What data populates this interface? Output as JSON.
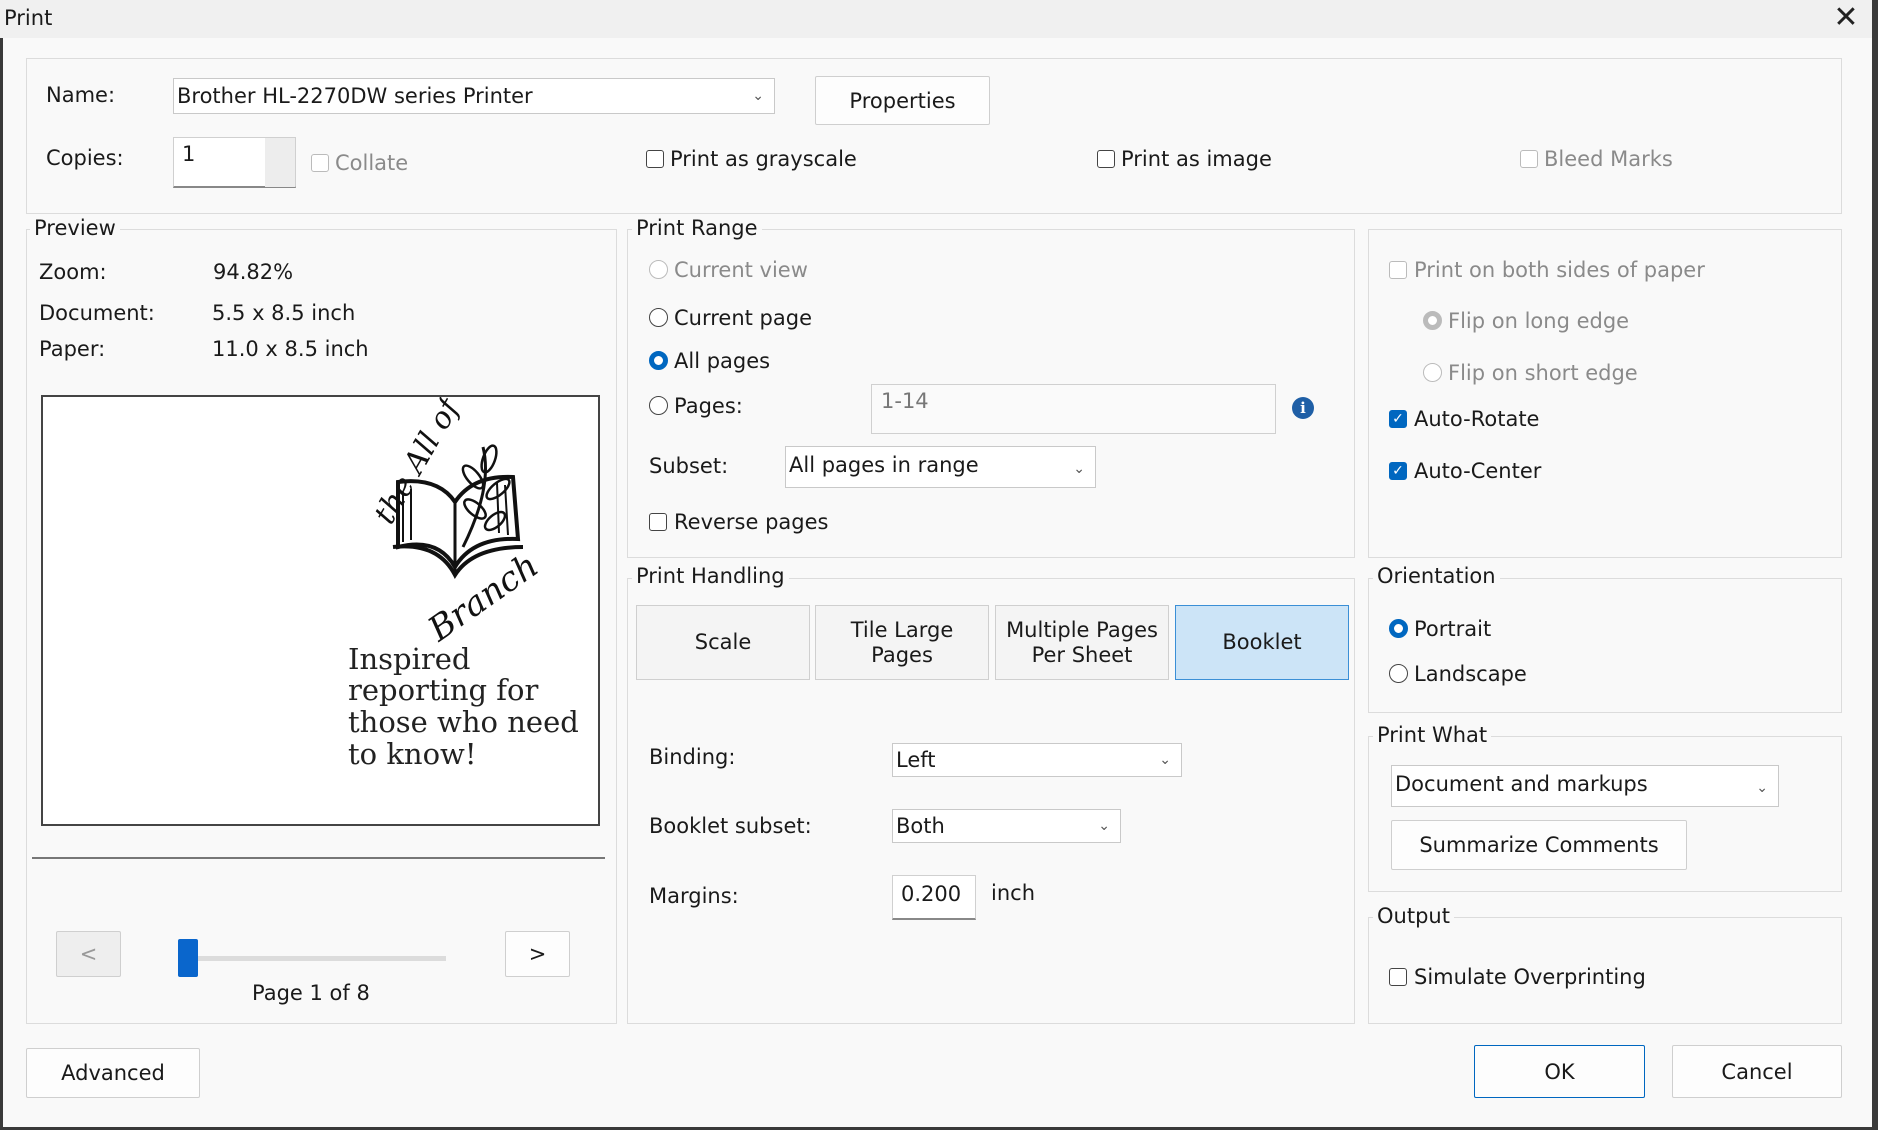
{
  "window": {
    "title": "Print",
    "close_glyph": "✕"
  },
  "printer": {
    "name_label": "Name:",
    "name_value": "Brother HL-2270DW series Printer",
    "properties_label": "Properties",
    "copies_label": "Copies:",
    "copies_value": "1",
    "collate_label": "Collate",
    "grayscale_label": "Print as grayscale",
    "image_label": "Print as image",
    "bleed_label": "Bleed Marks"
  },
  "preview": {
    "legend": "Preview",
    "zoom_label": "Zoom:",
    "zoom_value": "94.82%",
    "document_label": "Document:",
    "document_value": "5.5 x 8.5 inch",
    "paper_label": "Paper:",
    "paper_value": "11.0 x 8.5 inch",
    "logo_text_top": "the All of",
    "logo_text_bottom": "Branch",
    "tagline_1": "Inspired",
    "tagline_2": "reporting for",
    "tagline_3": "those who need",
    "tagline_4": "to know!",
    "prev_label": "<",
    "next_label": ">",
    "page_label": "Page 1 of 8",
    "slider_position": 0.0
  },
  "print_range": {
    "legend": "Print Range",
    "current_view": "Current view",
    "current_page": "Current page",
    "all_pages": "All pages",
    "pages_label": "Pages:",
    "pages_value": "1-14",
    "subset_label": "Subset:",
    "subset_value": "All pages in range",
    "reverse_label": "Reverse pages"
  },
  "duplex": {
    "both_sides": "Print on both sides of paper",
    "flip_long": "Flip on long edge",
    "flip_short": "Flip on short edge",
    "auto_rotate": "Auto-Rotate",
    "auto_center": "Auto-Center"
  },
  "handling": {
    "legend": "Print Handling",
    "scale": "Scale",
    "tile_1": "Tile Large",
    "tile_2": "Pages",
    "multi_1": "Multiple Pages",
    "multi_2": "Per Sheet",
    "booklet": "Booklet",
    "binding_label": "Binding:",
    "binding_value": "Left",
    "subset_label": "Booklet subset:",
    "subset_value": "Both",
    "margins_label": "Margins:",
    "margins_value": "0.200",
    "margins_unit": "inch"
  },
  "orientation": {
    "legend": "Orientation",
    "portrait": "Portrait",
    "landscape": "Landscape"
  },
  "print_what": {
    "legend": "Print What",
    "value": "Document and markups",
    "summarize": "Summarize Comments"
  },
  "output": {
    "legend": "Output",
    "simulate": "Simulate Overprinting"
  },
  "footer": {
    "advanced": "Advanced",
    "ok": "OK",
    "cancel": "Cancel"
  },
  "colors": {
    "accent": "#0067c0",
    "selected_tab": "#cce4f7"
  }
}
